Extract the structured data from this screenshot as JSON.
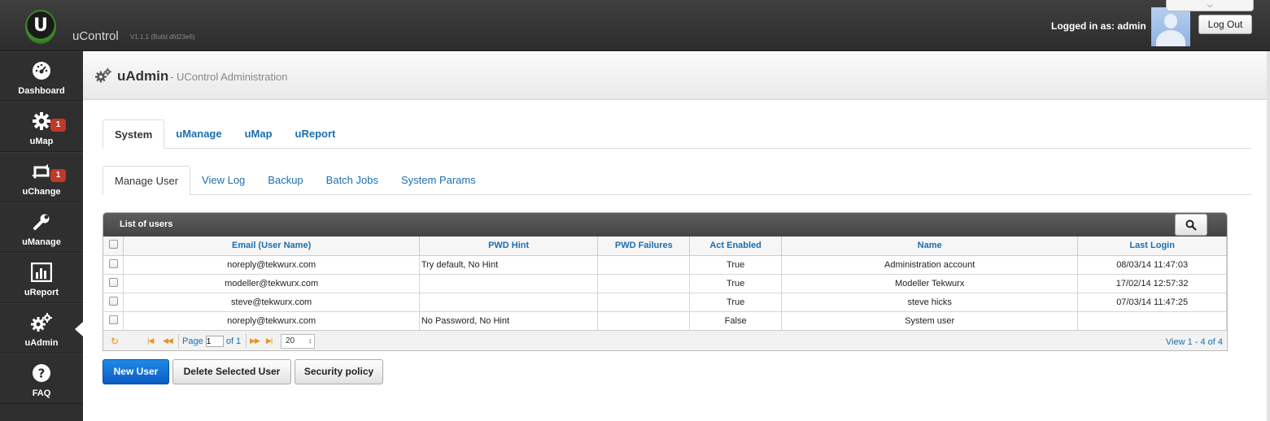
{
  "app": {
    "name": "uControl",
    "version": "V1.1.1 (Build dfd23e6)",
    "logo_letter": "U"
  },
  "user": {
    "logged_in_text": "Logged in as: admin",
    "logout_label": "Log Out"
  },
  "sidebar": {
    "items": [
      {
        "label": "Dashboard",
        "icon": "dashboard-icon"
      },
      {
        "label": "uMap",
        "icon": "gear-icon",
        "badge": "1"
      },
      {
        "label": "uChange",
        "icon": "retweet-icon",
        "badge": "1"
      },
      {
        "label": "uManage",
        "icon": "wrench-icon"
      },
      {
        "label": "uReport",
        "icon": "bar-chart-icon"
      },
      {
        "label": "uAdmin",
        "icon": "gears-icon",
        "active": true
      },
      {
        "label": "FAQ",
        "icon": "question-icon"
      }
    ]
  },
  "page": {
    "title": "uAdmin",
    "subtitle": "- UControl Administration"
  },
  "main_tabs": [
    {
      "label": "System",
      "active": true
    },
    {
      "label": "uManage"
    },
    {
      "label": "uMap"
    },
    {
      "label": "uReport"
    }
  ],
  "sub_tabs": [
    {
      "label": "Manage User",
      "active": true
    },
    {
      "label": "View Log"
    },
    {
      "label": "Backup"
    },
    {
      "label": "Batch Jobs"
    },
    {
      "label": "System Params"
    }
  ],
  "grid": {
    "caption": "List of users",
    "columns": [
      "Email (User Name)",
      "PWD Hint",
      "PWD Failures",
      "Act Enabled",
      "Name",
      "Last Login"
    ],
    "rows": [
      [
        "noreply@tekwurx.com",
        "Try default, No Hint",
        "",
        "True",
        "Administration account",
        "08/03/14 11:47:03"
      ],
      [
        "modeller@tekwurx.com",
        "",
        "",
        "True",
        "Modeller Tekwurx",
        "17/02/14 12:57:32"
      ],
      [
        "steve@tekwurx.com",
        "",
        "",
        "True",
        "steve hicks",
        "07/03/14 11:47:25"
      ],
      [
        "noreply@tekwurx.com",
        "No Password, No Hint",
        "",
        "False",
        "System user",
        ""
      ]
    ],
    "pager": {
      "page_label": "Page",
      "page_value": "1",
      "of_label": "of 1",
      "page_size": "20",
      "view_text": "View 1 - 4 of 4"
    }
  },
  "actions": {
    "new_user": "New User",
    "delete_user": "Delete Selected User",
    "security_policy": "Security policy"
  },
  "colors": {
    "accent": "#1a6fb0",
    "primary_button": "#0a5bc4",
    "badge": "#c0392b"
  }
}
